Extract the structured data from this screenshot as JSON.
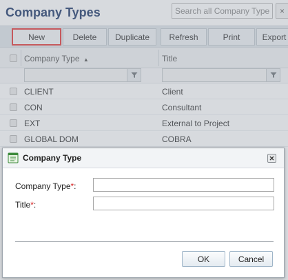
{
  "header": {
    "title": "Company Types",
    "search_placeholder": "Search all Company Types",
    "clear_glyph": "×"
  },
  "toolbar": {
    "new_label": "New",
    "delete_label": "Delete",
    "duplicate_label": "Duplicate",
    "refresh_label": "Refresh",
    "print_label": "Print",
    "export_label": "Export"
  },
  "grid": {
    "columns": [
      {
        "label": "Company Type",
        "sort_glyph": "▲"
      },
      {
        "label": "Title"
      }
    ],
    "rows": [
      {
        "company_type": "CLIENT",
        "title": "Client"
      },
      {
        "company_type": "CON",
        "title": "Consultant"
      },
      {
        "company_type": "EXT",
        "title": "External to Project"
      },
      {
        "company_type": "GLOBAL DOM",
        "title": "COBRA"
      }
    ]
  },
  "dialog": {
    "title": "Company Type",
    "fields": [
      {
        "label": "Company Type",
        "required_mark": "*",
        "suffix": ":",
        "value": ""
      },
      {
        "label": "Title",
        "required_mark": "*",
        "suffix": ":",
        "value": ""
      }
    ],
    "ok_label": "OK",
    "cancel_label": "Cancel"
  },
  "colors": {
    "title_blue": "#1f3a6b",
    "highlight_red": "#e53a3a",
    "required_red": "#d62020"
  },
  "icons": [
    "filter-icon",
    "sort-asc-icon",
    "dialog-form-icon",
    "close-icon",
    "clear-icon"
  ]
}
